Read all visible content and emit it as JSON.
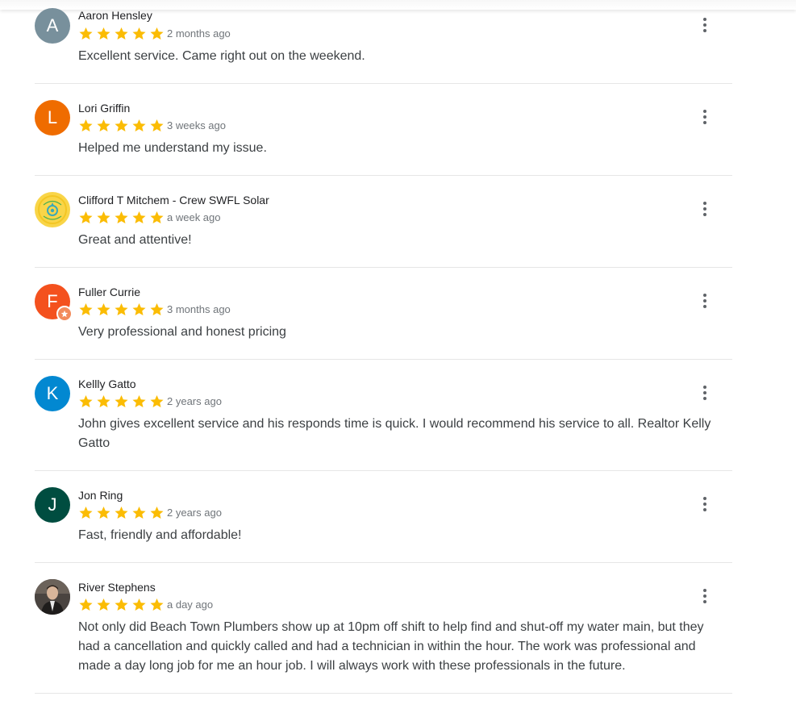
{
  "reviews": [
    {
      "initial": "A",
      "avatar_color": "#78909c",
      "name": "Aaron Hensley",
      "rating": 5,
      "date": "2 months ago",
      "text": "Excellent service. Came right out on the weekend."
    },
    {
      "initial": "L",
      "avatar_color": "#ef6c00",
      "name": "Lori Griffin",
      "rating": 5,
      "date": "3 weeks ago",
      "text": "Helped me understand my issue."
    },
    {
      "initial": "",
      "avatar_color": "#f9d548",
      "avatar_type": "logo",
      "name": "Clifford T Mitchem - Crew SWFL Solar",
      "rating": 5,
      "date": "a week ago",
      "text": "Great and attentive!"
    },
    {
      "initial": "F",
      "avatar_color": "#f4511e",
      "local_guide_badge": true,
      "name": "Fuller Currie",
      "rating": 5,
      "date": "3 months ago",
      "text": "Very professional and honest pricing"
    },
    {
      "initial": "K",
      "avatar_color": "#0288d1",
      "name": "Kellly Gatto",
      "rating": 5,
      "date": "2 years ago",
      "text": "John gives excellent service and his responds time is quick. I would recommend his service to all. Realtor Kelly Gatto"
    },
    {
      "initial": "J",
      "avatar_color": "#004d40",
      "name": "Jon Ring",
      "rating": 5,
      "date": "2 years ago",
      "text": "Fast, friendly and affordable!"
    },
    {
      "initial": "",
      "avatar_color": "#3e3a36",
      "avatar_type": "photo",
      "name": "River Stephens",
      "rating": 5,
      "date": "a day ago",
      "text": "Not only did Beach Town Plumbers show up at 10pm off shift to help find and shut-off my water main, but they had a cancellation and quickly called and had a technician in within the hour. The work was professional and made a day long job for me an hour job. I will always work with these professionals in the future."
    }
  ],
  "colors": {
    "star": "#fbbc04",
    "divider": "#e6e6e6",
    "date_text": "#70757a",
    "body_text": "#3c4043"
  },
  "icons": {
    "star": "star-icon",
    "menu": "more-vert-icon",
    "badge": "local-guide-star-icon"
  }
}
